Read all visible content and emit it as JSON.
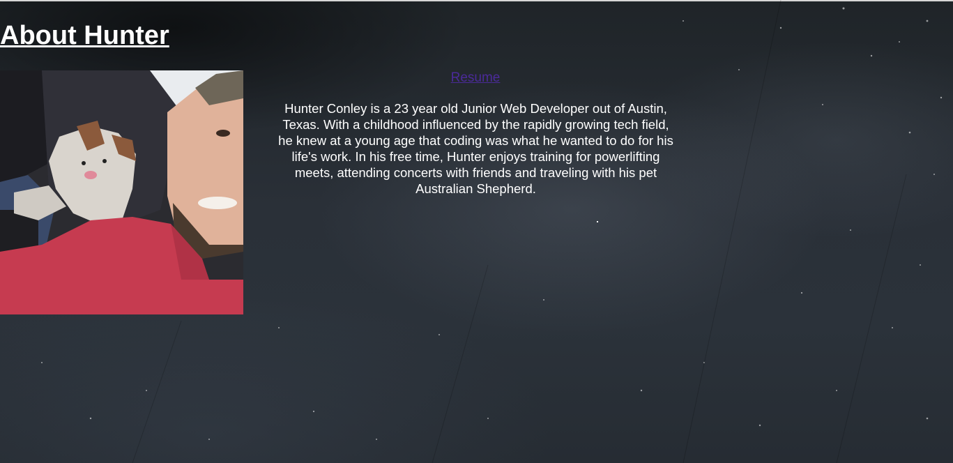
{
  "page": {
    "title": "About Hunter"
  },
  "profile": {
    "photo_alt": "Hunter with his Australian Shepherd"
  },
  "links": {
    "resume_label": "Resume"
  },
  "bio": {
    "text": "Hunter Conley is a 23 year old Junior Web Developer out of Austin, Texas. With a childhood influenced by the rapidly growing tech field, he knew at a young age that coding was what he wanted to do for his life's work. In his free time, Hunter enjoys training for powerlifting meets, attending concerts with friends and traveling with his pet Australian Shepherd."
  },
  "colors": {
    "background": "#2a3038",
    "text": "#ffffff",
    "link": "#4b2a9a"
  }
}
